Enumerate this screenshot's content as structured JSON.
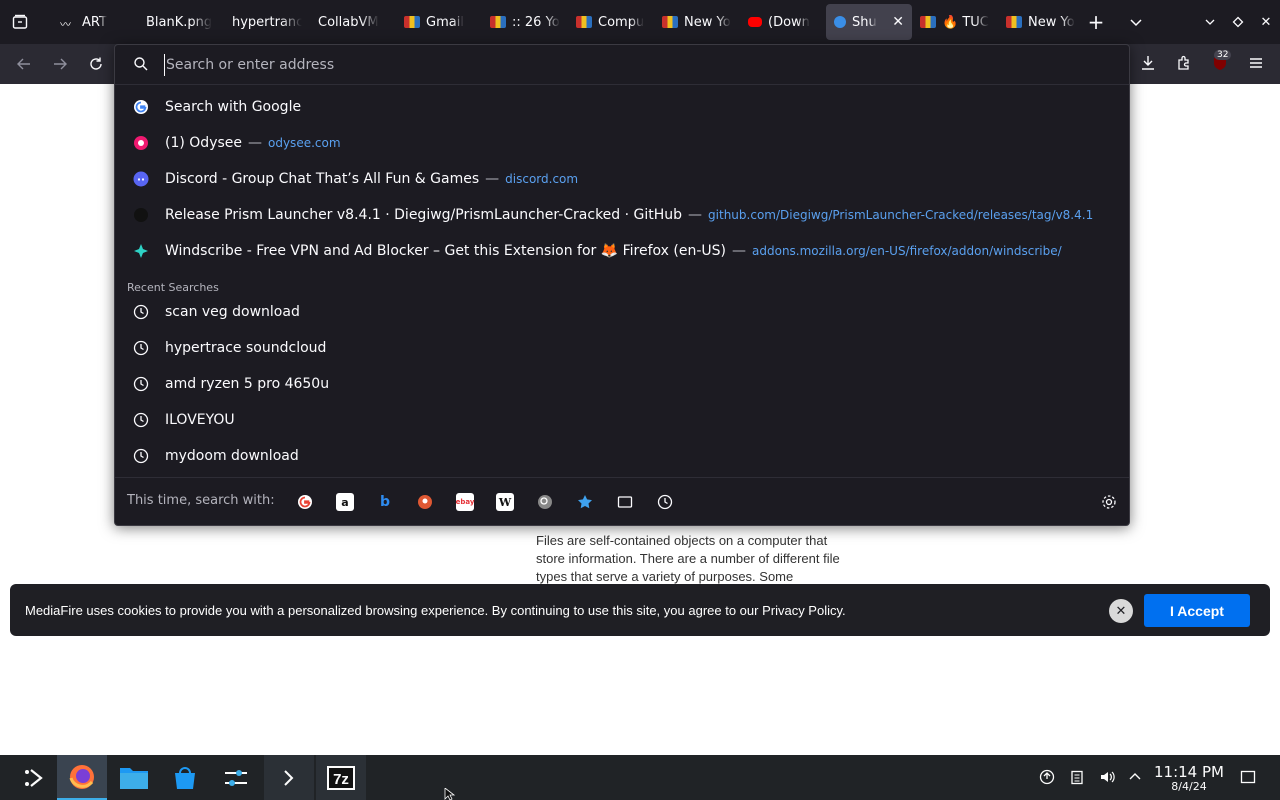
{
  "tabs": [
    {
      "title": "ART",
      "icon": "wave-icon"
    },
    {
      "title": "BlanK.png",
      "icon": "blank-icon"
    },
    {
      "title": "hypertrance",
      "icon": "blank-icon"
    },
    {
      "title": "CollabVM",
      "icon": "blank-icon"
    },
    {
      "title": "Gmail",
      "icon": "flag-icon"
    },
    {
      "title": ":: 26 Yo",
      "icon": "flag-icon"
    },
    {
      "title": "Compu",
      "icon": "flag-icon"
    },
    {
      "title": "New Yo",
      "icon": "flag-icon"
    },
    {
      "title": "(Down",
      "icon": "youtube-icon"
    },
    {
      "title": "Shu",
      "icon": "shark-icon",
      "active": true
    },
    {
      "title": "🔥 TUC",
      "icon": "flag-icon"
    },
    {
      "title": "New Yo",
      "icon": "flag-icon"
    }
  ],
  "urlbar": {
    "placeholder": "Search or enter address",
    "suggestions": [
      {
        "title": "Search with Google",
        "url": ""
      },
      {
        "title": "(1) Odysee",
        "url": "odysee.com"
      },
      {
        "title": "Discord - Group Chat That’s All Fun & Games",
        "url": "discord.com"
      },
      {
        "title": "Release Prism Launcher v8.4.1 · Diegiwg/PrismLauncher-Cracked · GitHub",
        "url": "github.com/Diegiwg/PrismLauncher-Cracked/releases/tag/v8.4.1"
      },
      {
        "title": "Windscribe - Free VPN and Ad Blocker – Get this Extension for 🦊 Firefox (en-US)",
        "url": "addons.mozilla.org/en-US/firefox/addon/windscribe/"
      }
    ],
    "separator": "—",
    "recent_heading": "Recent Searches",
    "recent": [
      "scan veg download",
      "hypertrace soundcloud",
      "amd ryzen 5 pro 4650u",
      "ILOVEYOU",
      "mydoom download"
    ],
    "oneoff_label": "This time, search with:"
  },
  "toolbar": {
    "extension_badge": "32"
  },
  "page": {
    "body_text": "Files are self-contained objects on a computer that store information. There are a number of different file types that serve a variety of purposes. Some"
  },
  "cookie": {
    "text": "MediaFire uses cookies to provide you with a personalized browsing experience. By continuing to use this site, you agree to our Privacy Policy.",
    "accept_label": "I Accept",
    "close_label": "✕"
  },
  "taskbar": {
    "time": "11:14 PM",
    "date": "8/4/24"
  },
  "colors": {
    "accent": "#0070f0",
    "link": "#5aa0ef",
    "urlbar_bg": "#1c1b22"
  }
}
